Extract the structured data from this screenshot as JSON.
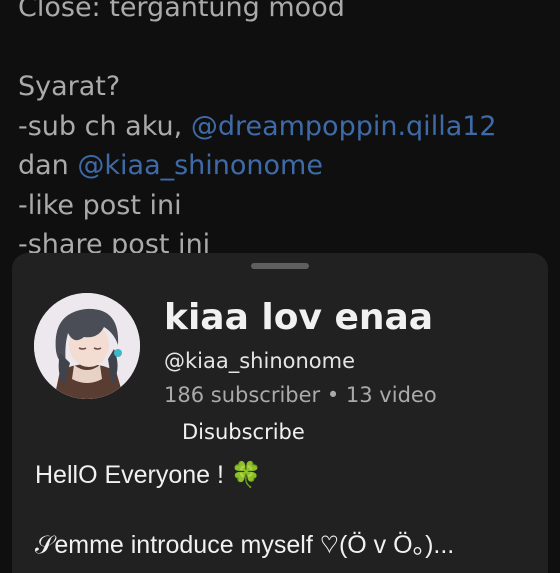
{
  "post": {
    "lines": [
      {
        "text": "Close: tergantung mood"
      },
      {
        "text": ""
      },
      {
        "text": "Syarat?"
      },
      {
        "prefix": "-sub ch aku, ",
        "link": "@dreampoppin.qilla12"
      },
      {
        "prefix": "dan ",
        "link": "@kiaa_shinonome"
      },
      {
        "text": "-like post ini"
      },
      {
        "text": "-share post ini"
      }
    ]
  },
  "sheet": {
    "channel_name": "kiaa lov enaa",
    "handle": "@kiaa_shinonome",
    "stats": "186 subscriber • 13 video",
    "unsubscribe_label": "Disubscribe",
    "description": {
      "line1": "HellO Everyone ! ",
      "line1_emoji": "🍀",
      "line2": "",
      "line3": "𝒮emme introduce myself ♡(Ö v Ö。)..."
    }
  },
  "colors": {
    "background": "#0f0f0f",
    "sheet": "#212121",
    "link": "#3e6ba8",
    "muted_text": "#aaaaaa"
  }
}
